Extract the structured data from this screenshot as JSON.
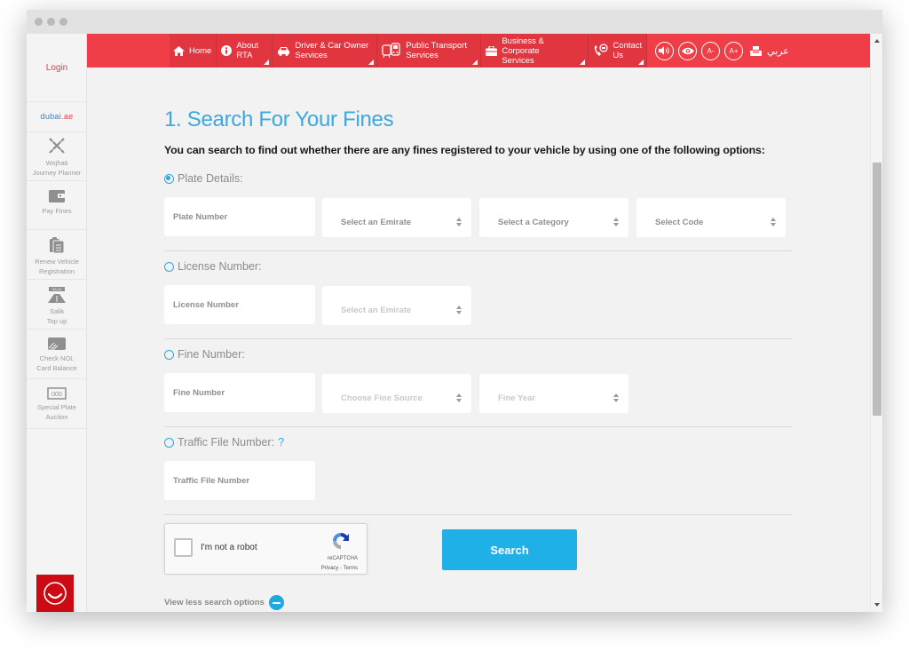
{
  "sidebar": {
    "login": "Login",
    "dubai_logo": {
      "main": "dubai",
      "suffix": ".ae"
    },
    "items": [
      {
        "icon": "journey-planner-icon",
        "label_1": "Wojhati",
        "label_2": "Journey Planner"
      },
      {
        "icon": "wallet-icon",
        "label_1": "Pay Fines",
        "label_2": ""
      },
      {
        "icon": "clipboard-icon",
        "label_1": "Renew Vehicle",
        "label_2": "Registration"
      },
      {
        "icon": "salik-icon",
        "label_1": "Salik",
        "label_2": "Top up"
      },
      {
        "icon": "nol-card-icon",
        "label_1": "Check NOL",
        "label_2": "Card Balance"
      },
      {
        "icon": "plate-icon",
        "label_1": "Special Plate",
        "label_2": "Auction"
      }
    ],
    "salik_badge": "SALIK",
    "plate_badge": "000",
    "feedback_icon": "smiley-icon"
  },
  "nav": {
    "items": [
      {
        "icon": "home-icon",
        "label_1": "Home",
        "label_2": "",
        "has_menu": false
      },
      {
        "icon": "info-icon",
        "label_1": "About",
        "label_2": "RTA",
        "has_menu": true
      },
      {
        "icon": "car-icon",
        "label_1": "Driver & Car Owner",
        "label_2": "Services",
        "has_menu": true
      },
      {
        "icon": "bus-icon",
        "label_1": "Public Transport",
        "label_2": "Services",
        "has_menu": true
      },
      {
        "icon": "briefcase-icon",
        "label_1": "Business & Corporate",
        "label_2": "Services",
        "has_menu": true
      },
      {
        "icon": "phone-chat-icon",
        "label_1": "Contact",
        "label_2": "Us",
        "has_menu": true
      }
    ],
    "tools": {
      "speaker": "speaker-icon",
      "eye": "eye-icon",
      "font_decrease": "A-",
      "font_increase": "A+",
      "print": "print-icon",
      "language": "عربي"
    }
  },
  "main": {
    "title": "1. Search For Your Fines",
    "intro": "You can search to find out whether there are any fines registered to your vehicle by using one of the following options:",
    "sections": {
      "plate": {
        "label": "Plate Details:",
        "selected": true,
        "plate_number_placeholder": "Plate Number",
        "emirate": "Select an Emirate",
        "category": "Select a Category",
        "code": "Select Code"
      },
      "license": {
        "label": "License Number:",
        "selected": false,
        "license_number_placeholder": "License Number",
        "emirate": "Select an Emirate"
      },
      "fine": {
        "label": "Fine Number:",
        "selected": false,
        "fine_number_placeholder": "Fine Number",
        "source": "Choose Fine Source",
        "year": "Fine Year"
      },
      "traffic_file": {
        "label": "Traffic File Number:",
        "help": "?",
        "selected": false,
        "traffic_file_placeholder": "Traffic File Number"
      }
    },
    "captcha": {
      "label": "I'm not a robot",
      "brand": "reCAPTCHA",
      "links": "Privacy - Terms",
      "checked": false
    },
    "search_button": "Search",
    "view_less": "View less search options"
  },
  "colors": {
    "nav_red": "#ef3e47",
    "accent_blue": "#1fb0e8",
    "title_blue": "#3ba8e0",
    "feedback_red": "#cc0a14"
  }
}
